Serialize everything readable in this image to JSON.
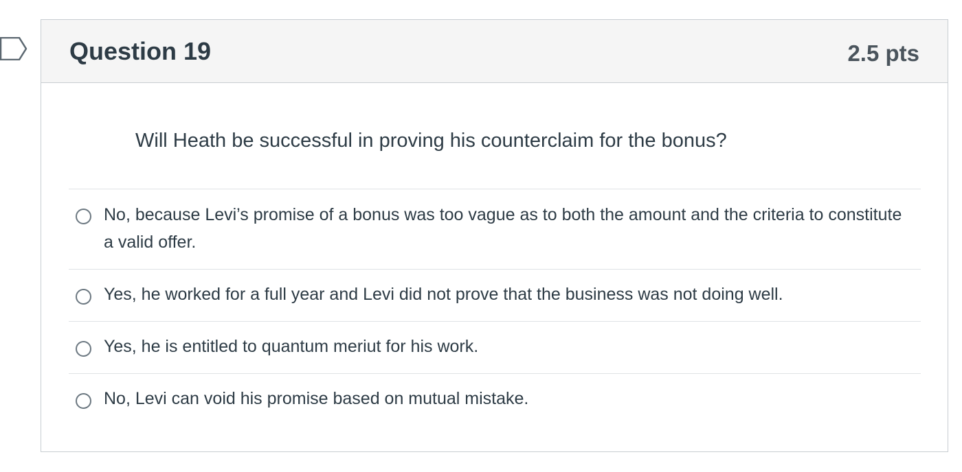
{
  "question": {
    "title": "Question 19",
    "points": "2.5 pts",
    "text": "Will Heath be successful in proving his counterclaim for the bonus?",
    "flag_icon": "flag-outline-icon"
  },
  "answers": [
    {
      "label": "No, because Levi’s promise of a bonus was too vague as to both the amount and the criteria to constitute a valid offer.",
      "selected": false
    },
    {
      "label": "Yes, he worked for a full year and Levi did not prove that the business was not doing well.",
      "selected": false
    },
    {
      "label": "Yes, he is entitled to quantum meriut for his work.",
      "selected": false
    },
    {
      "label": "No, Levi can void his promise based on mutual mistake.",
      "selected": false
    }
  ],
  "colors": {
    "text": "#2d3b45",
    "header_bg": "#f5f5f5",
    "border": "#c7cdd1",
    "divider": "#dfe2e5",
    "radio_border": "#6b7780"
  }
}
